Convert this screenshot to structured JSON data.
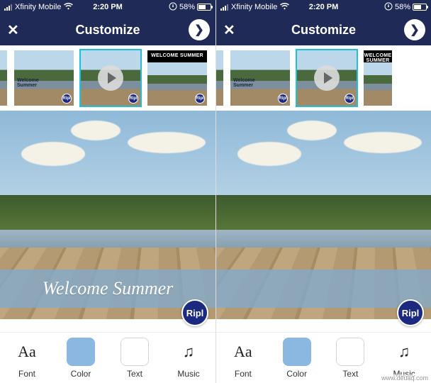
{
  "status": {
    "carrier": "Xfinity Mobile",
    "time": "2:20 PM",
    "rotation_lock_icon": "lock-rotation",
    "battery_percent": "58%"
  },
  "nav": {
    "title": "Customize",
    "close_glyph": "✕",
    "next_glyph": "❯"
  },
  "templates": {
    "welcome_label": "Welcome\nSummer",
    "top_label": "WELCOME SUMMER",
    "ripl": "Ripl"
  },
  "preview": {
    "left": {
      "overlay_text": "Welcome Summer",
      "show_overlay_text": true
    },
    "right": {
      "overlay_text": "",
      "show_overlay_text": false
    },
    "badge": "Ripl"
  },
  "tools": [
    {
      "id": "font",
      "label": "Font",
      "glyph": "Aa",
      "kind": "font"
    },
    {
      "id": "color",
      "label": "Color",
      "glyph": "",
      "kind": "swatch-color"
    },
    {
      "id": "text",
      "label": "Text",
      "glyph": "",
      "kind": "swatch-text"
    },
    {
      "id": "music",
      "label": "Music",
      "glyph": "♫",
      "kind": "music"
    }
  ],
  "watermark": "www.deuaq.com"
}
